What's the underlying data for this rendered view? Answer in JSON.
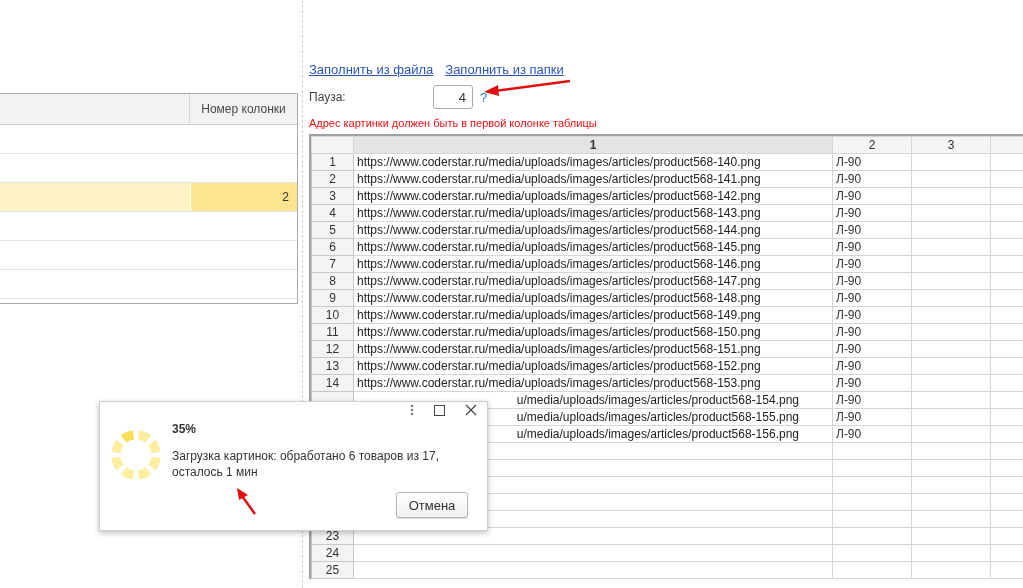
{
  "columns_table": {
    "header": "Номер колонки",
    "rows": [
      {
        "selected": false
      },
      {
        "selected": false
      },
      {
        "selected": true,
        "number": "2"
      },
      {
        "selected": false
      },
      {
        "selected": false
      },
      {
        "selected": false
      }
    ]
  },
  "form": {
    "links": [
      "Заполнить из файла",
      "Заполнить из папки"
    ],
    "pause": {
      "label": "Пауза:",
      "value": "4",
      "help": "?"
    },
    "warning": "Адрес картинки должен быть в первой колонке таблицы"
  },
  "sheet": {
    "column_headers": [
      "1",
      "2",
      "3"
    ],
    "rows": [
      {
        "kind": "data",
        "number": "1",
        "column_1": "https://www.coderstar.ru/media/uploads/images/articles/product568-140.png",
        "column_2": "Л-90"
      },
      {
        "kind": "data",
        "number": "2",
        "column_1": "https://www.coderstar.ru/media/uploads/images/articles/product568-141.png",
        "column_2": "Л-90"
      },
      {
        "kind": "data",
        "number": "3",
        "column_1": "https://www.coderstar.ru/media/uploads/images/articles/product568-142.png",
        "column_2": "Л-90"
      },
      {
        "kind": "data",
        "number": "4",
        "column_1": "https://www.coderstar.ru/media/uploads/images/articles/product568-143.png",
        "column_2": "Л-90"
      },
      {
        "kind": "data",
        "number": "5",
        "column_1": "https://www.coderstar.ru/media/uploads/images/articles/product568-144.png",
        "column_2": "Л-90"
      },
      {
        "kind": "data",
        "number": "6",
        "column_1": "https://www.coderstar.ru/media/uploads/images/articles/product568-145.png",
        "column_2": "Л-90"
      },
      {
        "kind": "data",
        "number": "7",
        "column_1": "https://www.coderstar.ru/media/uploads/images/articles/product568-146.png",
        "column_2": "Л-90"
      },
      {
        "kind": "data",
        "number": "8",
        "column_1": "https://www.coderstar.ru/media/uploads/images/articles/product568-147.png",
        "column_2": "Л-90"
      },
      {
        "kind": "data",
        "number": "9",
        "column_1": "https://www.coderstar.ru/media/uploads/images/articles/product568-148.png",
        "column_2": "Л-90"
      },
      {
        "kind": "data",
        "number": "10",
        "column_1": "https://www.coderstar.ru/media/uploads/images/articles/product568-149.png",
        "column_2": "Л-90"
      },
      {
        "kind": "data",
        "number": "11",
        "column_1": "https://www.coderstar.ru/media/uploads/images/articles/product568-150.png",
        "column_2": "Л-90"
      },
      {
        "kind": "data",
        "number": "12",
        "column_1": "https://www.coderstar.ru/media/uploads/images/articles/product568-151.png",
        "column_2": "Л-90"
      },
      {
        "kind": "data",
        "number": "13",
        "column_1": "https://www.coderstar.ru/media/uploads/images/articles/product568-152.png",
        "column_2": "Л-90"
      },
      {
        "kind": "data",
        "number": "14",
        "column_1": "https://www.coderstar.ru/media/uploads/images/articles/product568-153.png",
        "column_2": "Л-90"
      },
      {
        "kind": "covered",
        "column_1": "u/media/uploads/images/articles/product568-154.png",
        "column_2": "Л-90"
      },
      {
        "kind": "covered",
        "column_1": "u/media/uploads/images/articles/product568-155.png",
        "column_2": "Л-90"
      },
      {
        "kind": "covered",
        "column_1": "u/media/uploads/images/articles/product568-156.png",
        "column_2": "Л-90"
      },
      {
        "kind": "covered"
      },
      {
        "kind": "covered"
      },
      {
        "kind": "covered"
      },
      {
        "kind": "covered"
      },
      {
        "kind": "covered"
      },
      {
        "kind": "data",
        "number": "23"
      },
      {
        "kind": "data",
        "number": "24"
      },
      {
        "kind": "data",
        "number": "25"
      }
    ]
  },
  "dialog": {
    "title": "35%",
    "message": "Загрузка картинок: обработано 6 товаров из 17, осталось 1 мин",
    "buttons": [
      "Отмена"
    ]
  }
}
